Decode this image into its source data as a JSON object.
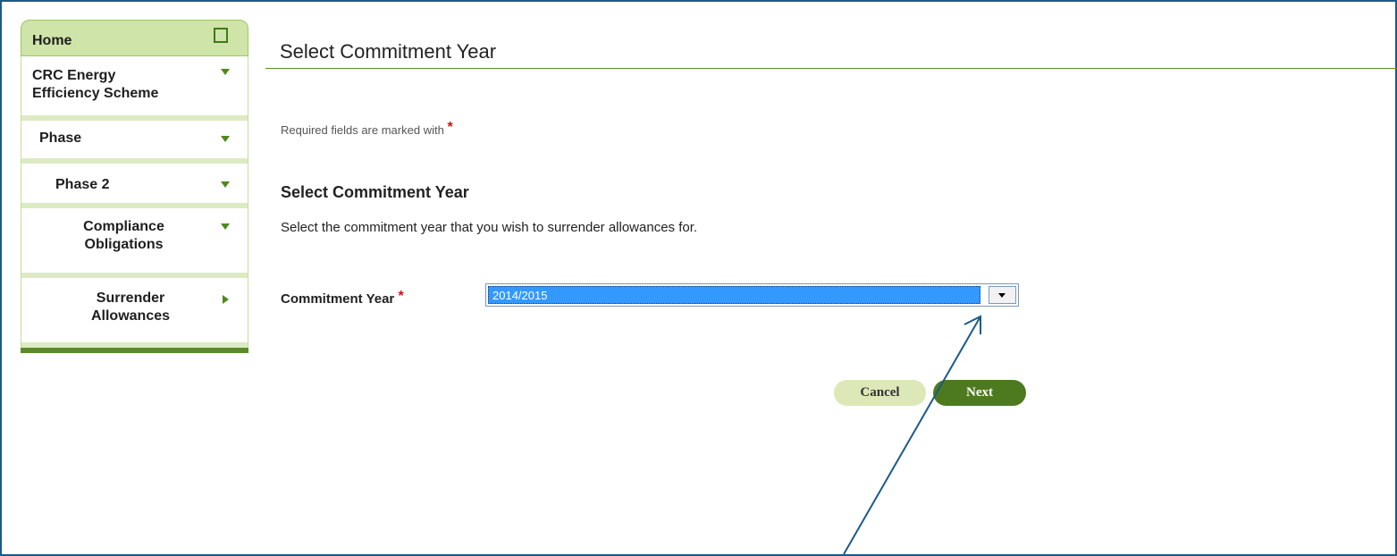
{
  "sidebar": {
    "items": [
      {
        "label": "Home"
      },
      {
        "label": "CRC Energy Efficiency Scheme"
      },
      {
        "label": "Phase"
      },
      {
        "label": "Phase 2"
      },
      {
        "label": "Compliance Obligations"
      },
      {
        "label": "Surrender Allowances"
      }
    ]
  },
  "main": {
    "page_title": "Select Commitment Year",
    "required_note": "Required fields are marked with",
    "required_star": "*",
    "section_title": "Select Commitment Year",
    "instruction": "Select the commitment year that you wish to surrender allowances for.",
    "field_label": "Commitment Year",
    "field_value": "2014/2015",
    "cancel_label": "Cancel",
    "next_label": "Next"
  },
  "colors": {
    "brand_green": "#4d7a1e",
    "light_green": "#cfe4a8",
    "selection_blue": "#3399ff",
    "annotation_arrow": "#1a5a8a"
  }
}
